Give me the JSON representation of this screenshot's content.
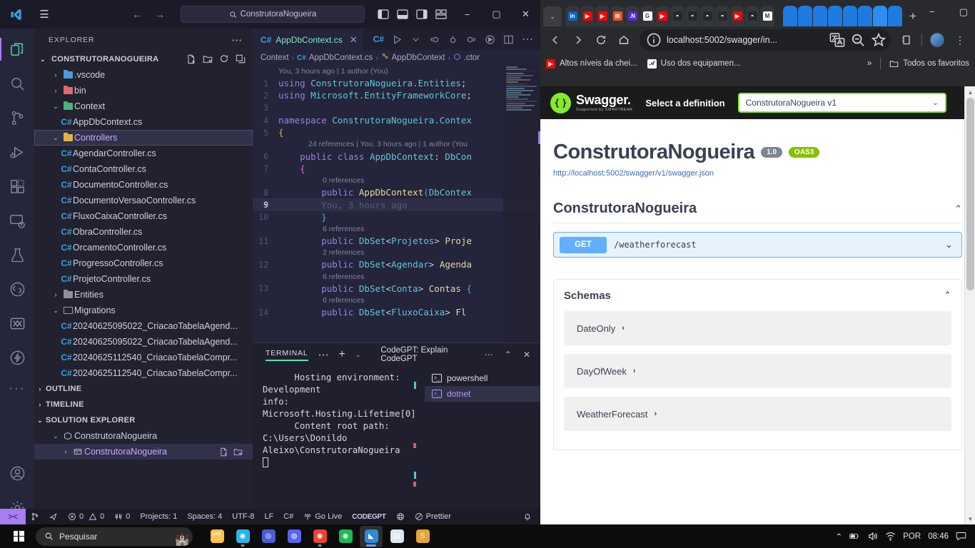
{
  "vscode": {
    "titlebar": {
      "search_value": "ConstrutoraNogueira",
      "back_label": "←",
      "forward_label": "→",
      "minimize_label": "−",
      "maximize_label": "▢",
      "close_label": "✕"
    },
    "activitybar": [
      {
        "name": "explorer",
        "title": "Explorer"
      },
      {
        "name": "search",
        "title": "Search"
      },
      {
        "name": "source-control",
        "title": "Source Control"
      },
      {
        "name": "run-and-debug",
        "title": "Run and Debug"
      },
      {
        "name": "extensions",
        "title": "Extensions"
      },
      {
        "name": "remote-explorer",
        "title": "Remote Explorer"
      },
      {
        "name": "testing",
        "title": "Testing"
      },
      {
        "name": "codegpt",
        "title": "CodeGPT"
      },
      {
        "name": "visual-studio",
        "title": "Visual Studio"
      },
      {
        "name": "thunder-client",
        "title": "Thunder Client"
      },
      {
        "name": "more",
        "title": "Additional Views"
      },
      {
        "name": "accounts",
        "title": "Accounts"
      },
      {
        "name": "settings",
        "title": "Manage"
      }
    ],
    "sidebar": {
      "header": "EXPLORER",
      "root_label": "CONSTRUTORANOGUEIRA",
      "tree": [
        {
          "label": ".vscode",
          "type": "folder",
          "color": "blue",
          "indent": 1,
          "expanded": false
        },
        {
          "label": "bin",
          "type": "folder",
          "color": "red",
          "indent": 1,
          "expanded": false
        },
        {
          "label": "Context",
          "type": "folder",
          "color": "green",
          "indent": 1,
          "expanded": true
        },
        {
          "label": "AppDbContext.cs",
          "type": "cs",
          "indent": 2
        },
        {
          "label": "Controllers",
          "type": "folder",
          "color": "yellow",
          "indent": 1,
          "expanded": true,
          "selected": true
        },
        {
          "label": "AgendarController.cs",
          "type": "cs",
          "indent": 2
        },
        {
          "label": "ContaController.cs",
          "type": "cs",
          "indent": 2
        },
        {
          "label": "DocumentoController.cs",
          "type": "cs",
          "indent": 2
        },
        {
          "label": "DocumentoVersaoController.cs",
          "type": "cs",
          "indent": 2
        },
        {
          "label": "FluxoCaixaController.cs",
          "type": "cs",
          "indent": 2
        },
        {
          "label": "ObraController.cs",
          "type": "cs",
          "indent": 2
        },
        {
          "label": "OrcamentoController.cs",
          "type": "cs",
          "indent": 2
        },
        {
          "label": "ProgressoController.cs",
          "type": "cs",
          "indent": 2
        },
        {
          "label": "ProjetoController.cs",
          "type": "cs",
          "indent": 2
        },
        {
          "label": "Entities",
          "type": "folder",
          "color": "grey",
          "indent": 1,
          "expanded": false
        },
        {
          "label": "Migrations",
          "type": "folder-open",
          "color": "grey",
          "indent": 1,
          "expanded": true
        },
        {
          "label": "20240625095022_CriacaoTabelaAgend...",
          "type": "cs",
          "indent": 2
        },
        {
          "label": "20240625095022_CriacaoTabelaAgend...",
          "type": "cs",
          "indent": 2
        },
        {
          "label": "20240625112540_CriacaoTabelaCompr...",
          "type": "cs",
          "indent": 2
        },
        {
          "label": "20240625112540_CriacaoTabelaCompr...",
          "type": "cs",
          "indent": 2
        }
      ],
      "sections": [
        {
          "label": "OUTLINE",
          "expanded": false
        },
        {
          "label": "TIMELINE",
          "expanded": false
        },
        {
          "label": "SOLUTION EXPLORER",
          "expanded": true
        }
      ],
      "solution": [
        {
          "label": "ConstrutoraNogueira",
          "type": "solution",
          "indent": 1,
          "expanded": true
        },
        {
          "label": "ConstrutoraNogueira",
          "type": "project",
          "indent": 2,
          "selected": true
        }
      ]
    },
    "editor": {
      "tab_label": "AppDbContext.cs",
      "tab_close": "✕",
      "breadcrumb": [
        "Context",
        "AppDbContext.cs",
        "AppDbContext",
        ".ctor"
      ],
      "codelens_top": "You, 3 hours ago | 1 author (You)",
      "lines": [
        {
          "n": "1",
          "tokens": [
            {
              "t": "using ",
              "c": "kw"
            },
            {
              "t": "ConstrutoraNogueira.Entities",
              "c": "ns"
            },
            {
              "t": ";",
              "c": "punc"
            }
          ]
        },
        {
          "n": "2",
          "tokens": [
            {
              "t": "using ",
              "c": "kw"
            },
            {
              "t": "Microsoft.EntityFrameworkCore",
              "c": "ns"
            },
            {
              "t": ";",
              "c": "punc"
            }
          ]
        },
        {
          "n": "3",
          "tokens": []
        },
        {
          "n": "4",
          "tokens": [
            {
              "t": "namespace ",
              "c": "kw"
            },
            {
              "t": "ConstrutoraNogueira.Conte",
              "c": "ns"
            },
            {
              "t": "x",
              "c": "ns"
            }
          ]
        },
        {
          "n": "5",
          "tokens": [
            {
              "t": "{",
              "c": "brace"
            }
          ]
        },
        {
          "n": "6",
          "lens": "24 references | You, 3 hours ago | 1 author (You",
          "tokens": [
            {
              "t": "    ",
              "c": "punc"
            },
            {
              "t": "public class ",
              "c": "kw"
            },
            {
              "t": "AppDbContext",
              "c": "ty"
            },
            {
              "t": ": ",
              "c": "punc"
            },
            {
              "t": "DbCo",
              "c": "ty"
            },
            {
              "t": "n",
              "c": "ty"
            }
          ]
        },
        {
          "n": "7",
          "tokens": [
            {
              "t": "    ",
              "c": "punc"
            },
            {
              "t": "{",
              "c": "brace2"
            }
          ]
        },
        {
          "n": "8",
          "lens": "0 references",
          "tokens": [
            {
              "t": "        ",
              "c": "punc"
            },
            {
              "t": "public ",
              "c": "kw"
            },
            {
              "t": "AppDbContext",
              "c": "fn"
            },
            {
              "t": "(",
              "c": "brace3"
            },
            {
              "t": "DbConte",
              "c": "ty"
            },
            {
              "t": "x",
              "c": "ty"
            }
          ]
        },
        {
          "n": "9",
          "highlight": true,
          "ghost": "        You, 3 hours ago",
          "tokens": []
        },
        {
          "n": "10",
          "tokens": [
            {
              "t": "        ",
              "c": "punc"
            },
            {
              "t": "}",
              "c": "brace3"
            }
          ]
        },
        {
          "n": "11",
          "lens": "6 references",
          "tokens": [
            {
              "t": "        ",
              "c": "punc"
            },
            {
              "t": "public ",
              "c": "kw"
            },
            {
              "t": "DbSet",
              "c": "ty"
            },
            {
              "t": "<",
              "c": "punc"
            },
            {
              "t": "Projetos",
              "c": "ty"
            },
            {
              "t": "> ",
              "c": "punc"
            },
            {
              "t": "Proje",
              "c": "fn"
            }
          ]
        },
        {
          "n": "12",
          "lens": "2 references",
          "tokens": [
            {
              "t": "        ",
              "c": "punc"
            },
            {
              "t": "public ",
              "c": "kw"
            },
            {
              "t": "DbSet",
              "c": "ty"
            },
            {
              "t": "<",
              "c": "punc"
            },
            {
              "t": "Agendar",
              "c": "ty"
            },
            {
              "t": "> ",
              "c": "punc"
            },
            {
              "t": "Agenda",
              "c": "fn"
            }
          ]
        },
        {
          "n": "13",
          "lens": "6 references",
          "tokens": [
            {
              "t": "        ",
              "c": "punc"
            },
            {
              "t": "public ",
              "c": "kw"
            },
            {
              "t": "DbSet",
              "c": "ty"
            },
            {
              "t": "<",
              "c": "punc"
            },
            {
              "t": "Conta",
              "c": "ty"
            },
            {
              "t": "> ",
              "c": "punc"
            },
            {
              "t": "Contas ",
              "c": "fn"
            },
            {
              "t": "{",
              "c": "brace3"
            }
          ]
        },
        {
          "n": "14",
          "lens": "6 references",
          "tokens": [
            {
              "t": "        ",
              "c": "punc"
            },
            {
              "t": "public ",
              "c": "kw"
            },
            {
              "t": "DbSet",
              "c": "ty"
            },
            {
              "t": "<",
              "c": "punc"
            },
            {
              "t": "FluxoCaixa",
              "c": "ty"
            },
            {
              "t": "> ",
              "c": "punc"
            },
            {
              "t": "Fl",
              "c": "fn"
            }
          ]
        }
      ]
    },
    "panel": {
      "tab_label": "TERMINAL",
      "dots_label": "⋯",
      "add_label": "+",
      "chevron_label": "⌄",
      "title": "CodeGPT: Explain CodeGPT",
      "more_label": "⋯",
      "chevron_up_label": "⌃",
      "close_label": "✕",
      "output": "      Hosting environment: Development\ninfo: Microsoft.Hosting.Lifetime[0]\n      Content root path: C:\\Users\\Donildo Aleixo\\ConstrutoraNogueira\n",
      "terminals": [
        {
          "label": "powershell",
          "selected": false
        },
        {
          "label": "dotnet",
          "selected": true
        }
      ]
    },
    "statusbar": {
      "remote_label": "><",
      "items": [
        {
          "name": "source-control-branch",
          "label": ""
        },
        {
          "name": "live-share",
          "label": ""
        },
        {
          "name": "problems",
          "label": "0  0"
        },
        {
          "name": "ports",
          "label": "0"
        },
        {
          "name": "projects",
          "label": "Projects: 1"
        },
        {
          "name": "indentation",
          "label": "Spaces: 4"
        },
        {
          "name": "encoding",
          "label": "UTF-8"
        },
        {
          "name": "eol",
          "label": "LF"
        },
        {
          "name": "language-mode",
          "label": "C#"
        },
        {
          "name": "go-live",
          "label": "Go Live"
        },
        {
          "name": "codegpt",
          "label": "CODEGPT"
        },
        {
          "name": "globe",
          "label": ""
        },
        {
          "name": "prettier",
          "label": "Prettier"
        },
        {
          "name": "notifications",
          "label": ""
        }
      ],
      "errors": "0",
      "warnings": "0",
      "ports": "0"
    }
  },
  "chrome": {
    "tabstrip": {
      "chevron_label": "⌄",
      "newtab_label": "+",
      "minimize_label": "−",
      "maximize_label": "▢",
      "close_label": "✕",
      "tabs": [
        {
          "name": "linkedin",
          "color": "#0a66c2",
          "glyph": "in"
        },
        {
          "name": "youtube",
          "color": "#ff0000",
          "glyph": "▶"
        },
        {
          "name": "youtube",
          "color": "#ff0000",
          "glyph": "▶"
        },
        {
          "name": "microsoft",
          "color": "#f25022",
          "glyph": "⊞"
        },
        {
          "name": "dotnet",
          "color": "#512bd4",
          "glyph": ".N"
        },
        {
          "name": "google",
          "color": "#ffffff",
          "glyph": "G"
        },
        {
          "name": "youtube",
          "color": "#ff0000",
          "glyph": "▶"
        },
        {
          "name": "github",
          "color": "#24292e",
          "glyph": "◓"
        },
        {
          "name": "github",
          "color": "#24292e",
          "glyph": "◓"
        },
        {
          "name": "github",
          "color": "#24292e",
          "glyph": "◓"
        },
        {
          "name": "github",
          "color": "#24292e",
          "glyph": "◓"
        },
        {
          "name": "youtube",
          "color": "#ff0000",
          "glyph": "▶"
        },
        {
          "name": "github",
          "color": "#24292e",
          "glyph": "◓"
        },
        {
          "name": "gmail",
          "color": "#ffffff",
          "glyph": "M"
        }
      ],
      "group_tabs": [
        {
          "name": "swagger-tab",
          "light": false
        },
        {
          "name": "swagger-tab",
          "light": false
        },
        {
          "name": "swagger-tab",
          "light": false
        },
        {
          "name": "swagger-tab",
          "light": false
        },
        {
          "name": "swagger-tab",
          "light": false
        },
        {
          "name": "swagger-tab",
          "light": false
        },
        {
          "name": "swagger-tab-active",
          "light": true
        },
        {
          "name": "github-tab",
          "light": false
        }
      ]
    },
    "toolbar": {
      "back_label": "←",
      "forward_label": "→",
      "reload_label": "⟳",
      "home_label": "⌂",
      "url": "localhost:5002/swagger/in...",
      "translate_label": "文",
      "zoom_label": "⊖",
      "bookmark_label": "☆",
      "extensions_label": "⧉",
      "menu_label": "⋮"
    },
    "bookmarks": {
      "items": [
        {
          "label": "Altos níveis da chei...",
          "favicon_color": "#ff0000",
          "glyph": "▶"
        },
        {
          "label": "Uso dos equipamen...",
          "favicon_color": "#ffffff",
          "glyph": "𝒜"
        }
      ],
      "overflow_label": "»",
      "all_label": "Todos os favoritos"
    }
  },
  "swagger": {
    "topbar": {
      "logo_text": "Swagger.",
      "logo_sub": "Supported by SMARTBEAR",
      "select_label": "Select a definition",
      "selected_definition": "ConstrutoraNogueira v1",
      "chevron": "⌄"
    },
    "info": {
      "title": "ConstrutoraNogueira",
      "version_badge": "1.0",
      "oas_badge": "OAS3",
      "spec_url": "http://localhost:5002/swagger/v1/swagger.json"
    },
    "section": {
      "title": "ConstrutoraNogueira",
      "collapse_icon": "⌃"
    },
    "operations": [
      {
        "method": "GET",
        "path": "/weatherforecast",
        "expand_icon": "⌄"
      }
    ],
    "schemas": {
      "title": "Schemas",
      "collapse_icon": "⌃",
      "models": [
        {
          "name": "DateOnly",
          "arrow": "›"
        },
        {
          "name": "DayOfWeek",
          "arrow": "›"
        },
        {
          "name": "WeatherForecast",
          "arrow": "›"
        }
      ]
    }
  },
  "taskbar": {
    "search_placeholder": "Pesquisar",
    "apps": [
      {
        "name": "file-explorer",
        "color": "#ffc247",
        "state": "idle"
      },
      {
        "name": "microsoft-edge",
        "color": "#2ab3e6",
        "state": "running"
      },
      {
        "name": "office",
        "color": "#4a5cd6",
        "state": "idle"
      },
      {
        "name": "discord",
        "color": "#5865f2",
        "state": "idle"
      },
      {
        "name": "google-chrome",
        "color": "#ea4335",
        "state": "running"
      },
      {
        "name": "spotify",
        "color": "#1db954",
        "state": "idle"
      },
      {
        "name": "visual-studio-code",
        "color": "#2e8ad6",
        "state": "active"
      },
      {
        "name": "notepad",
        "color": "#dfe6f0",
        "state": "idle"
      },
      {
        "name": "sublime-text",
        "color": "#e8a33d",
        "state": "idle"
      }
    ],
    "tray": {
      "chevron": "⌃",
      "language": "POR",
      "time": "08:46"
    }
  }
}
